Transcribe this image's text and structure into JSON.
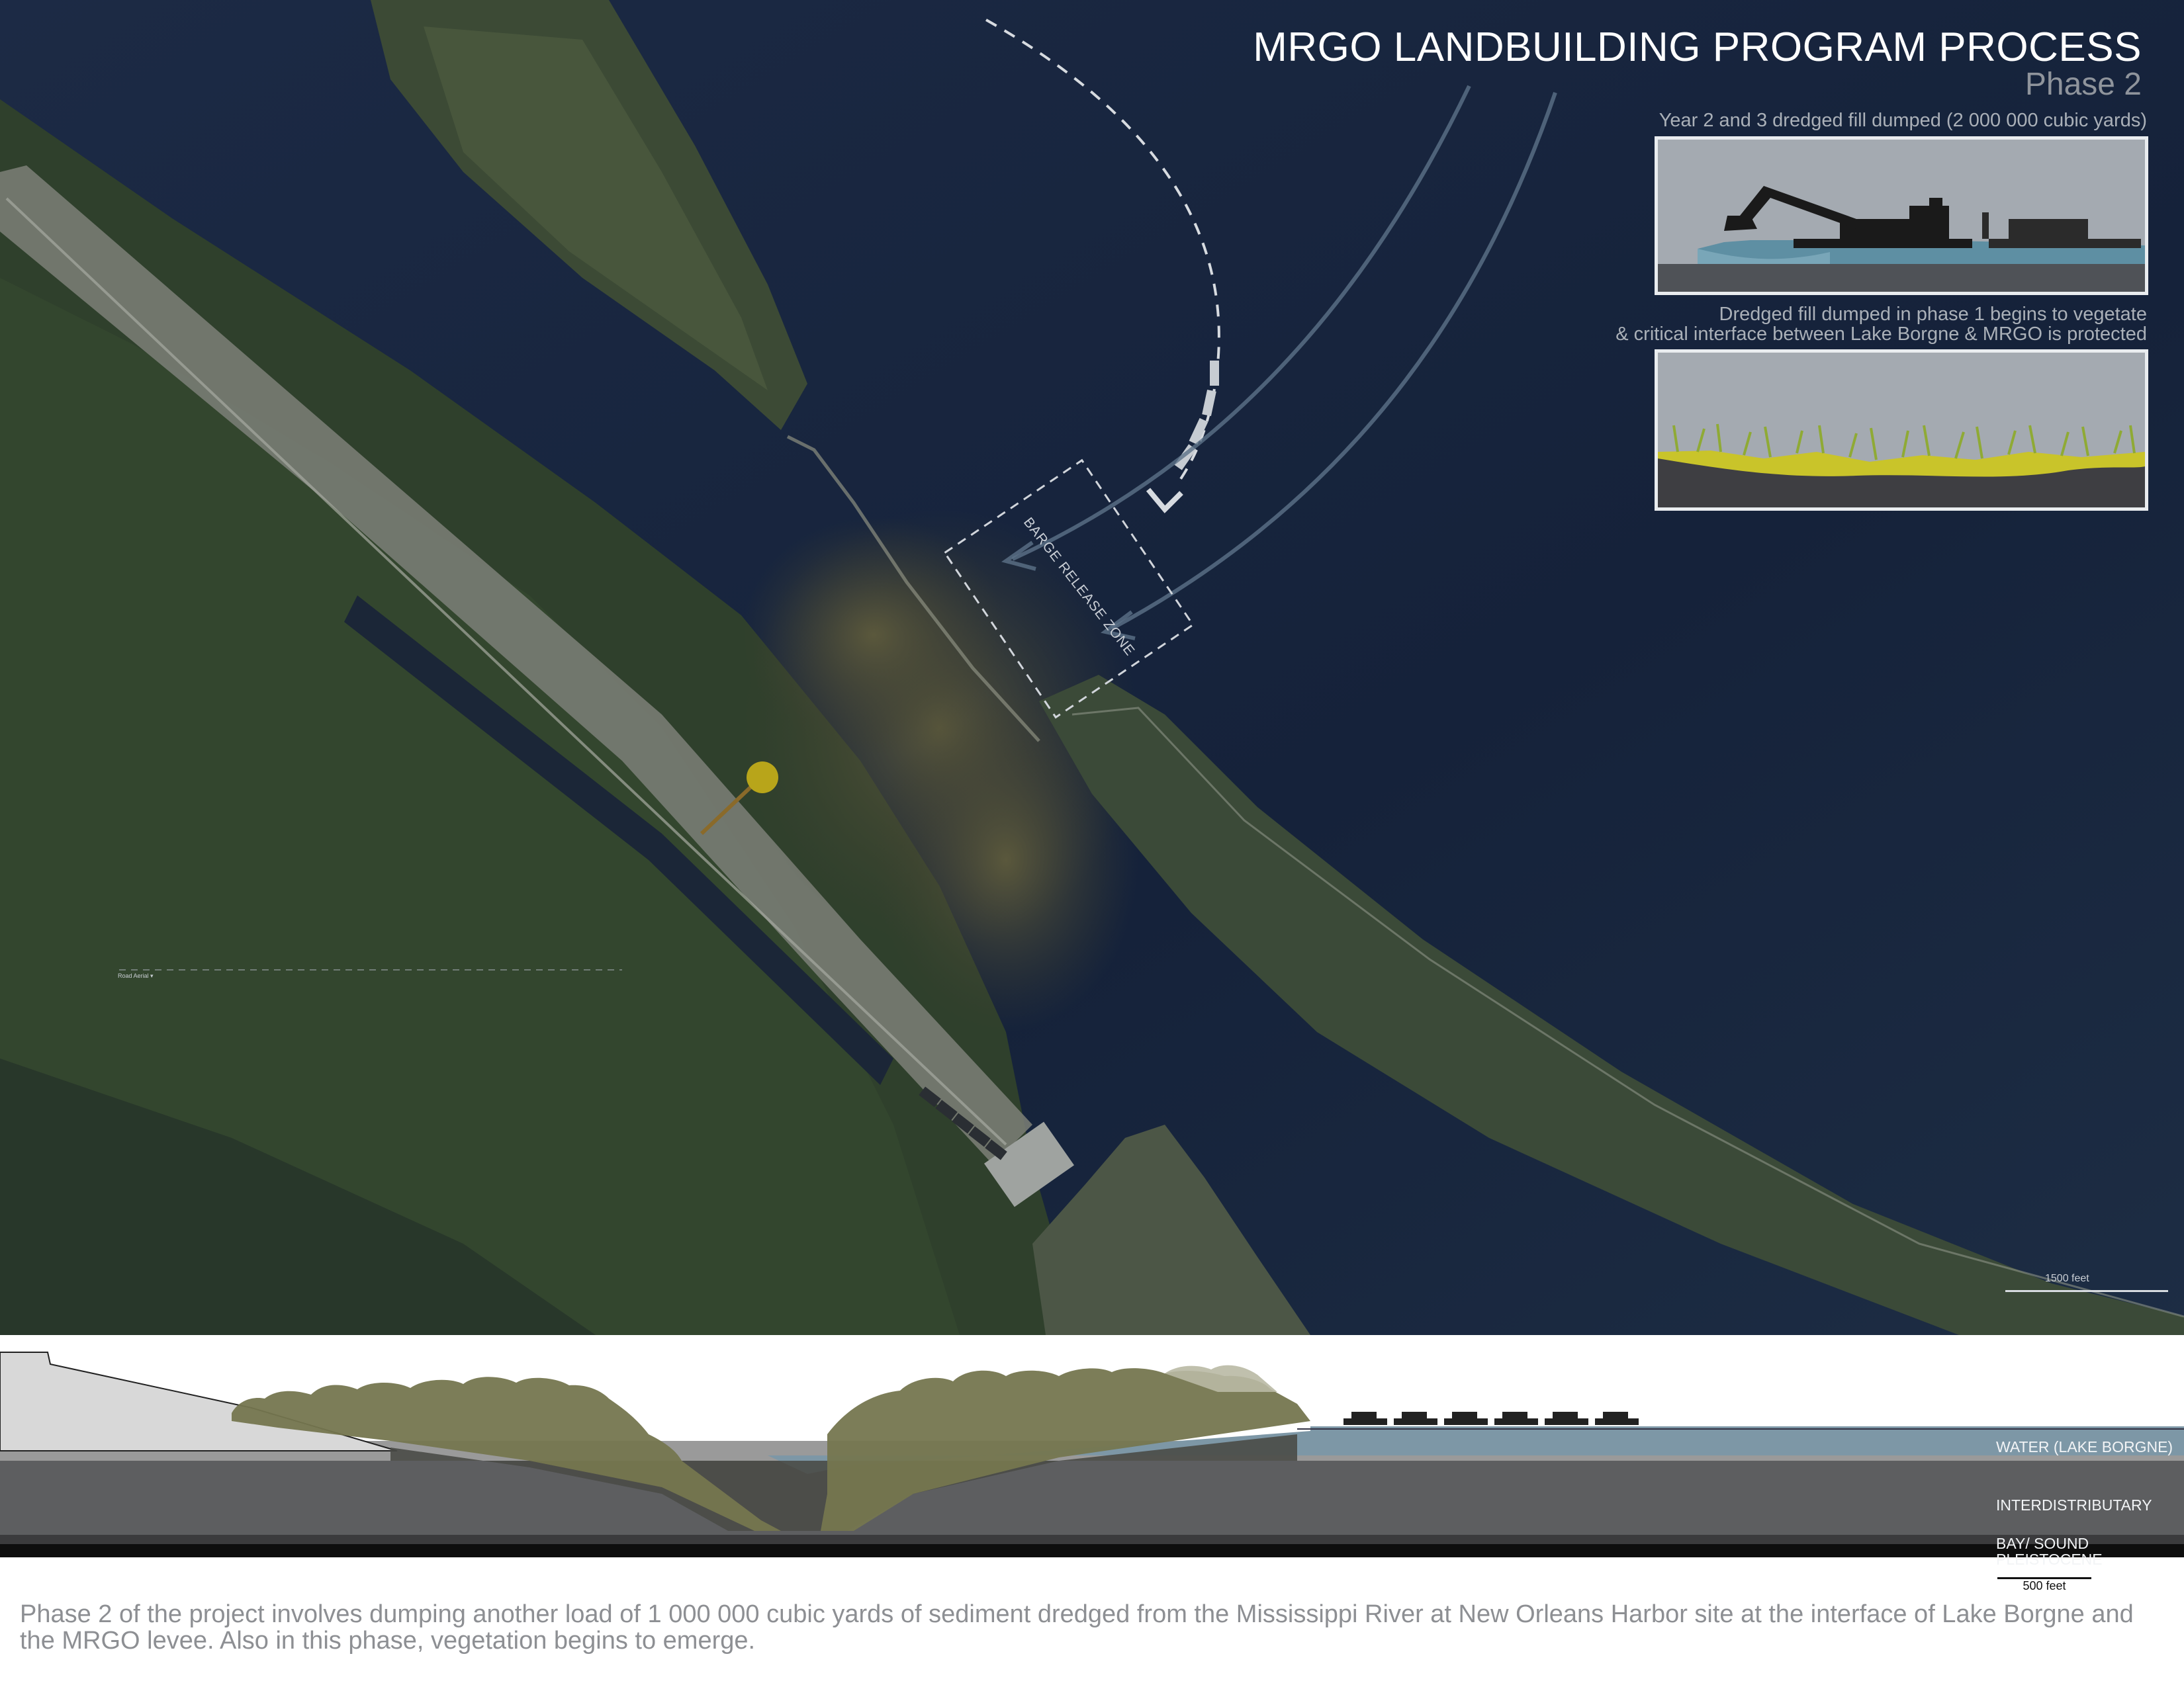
{
  "header": {
    "title": "MRGO LANDBUILDING PROGRAM PROCESS",
    "phase": "Phase 2"
  },
  "inset_top": {
    "caption": "Year 2 and 3 dredged fill dumped (2 000 000 cubic yards)"
  },
  "inset_bottom": {
    "caption_line1": "Dredged fill dumped in phase 1 begins to vegetate",
    "caption_line2": "& critical interface between Lake Borgne & MRGO is protected"
  },
  "map": {
    "zone_label": "BARGE RELEASE ZONE",
    "scale_label": "1500 feet",
    "map_control": "Road  Aerial ▾",
    "colors": {
      "water": "#16243d",
      "land": "#2e3f2c",
      "sediment": "#4b4a33",
      "marker": "#b8a51a"
    }
  },
  "section": {
    "layers": [
      "WATER (LAKE BORGNE)",
      "INTERDISTRIBUTARY",
      "BAY/ SOUND",
      "PLEISTOCENE"
    ],
    "scale_label": "500 feet"
  },
  "description": "Phase 2 of the project involves dumping another load of 1 000 000 cubic yards of sediment dredged from the Mississippi River at New Orleans Harbor site at the interface of Lake Borgne and the MRGO levee.  Also in this phase, vegetation begins to emerge."
}
